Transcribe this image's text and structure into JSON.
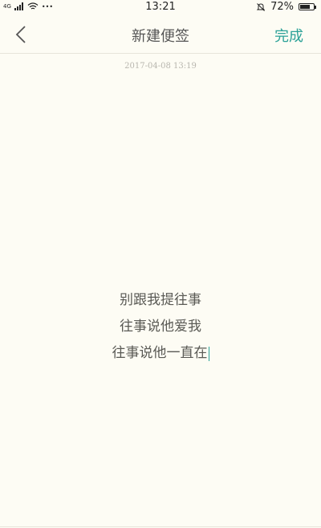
{
  "status_bar": {
    "signal_label": "4G",
    "dots": "•••",
    "time": "13:21",
    "battery_text": "72%",
    "battery_level": 0.72
  },
  "header": {
    "title": "新建便签",
    "done_label": "完成"
  },
  "note": {
    "timestamp": "2017-04-08 13:19",
    "lines": [
      "别跟我提往事",
      "往事说他爱我",
      "往事说他一直在"
    ]
  },
  "colors": {
    "background": "#fdfcf4",
    "accent": "#2aa197",
    "text": "#5a5a55",
    "timestamp": "#b8b6ae"
  }
}
